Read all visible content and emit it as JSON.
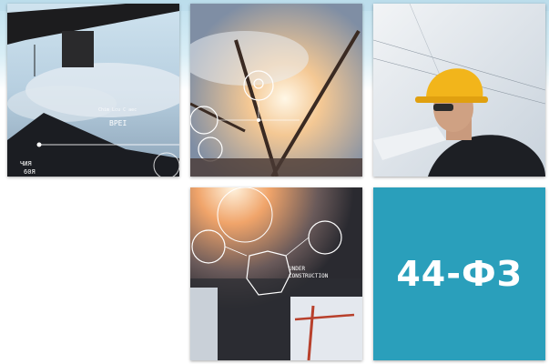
{
  "tiles": [
    {
      "id": "tile1",
      "overlay_texts": [
        "BPEI",
        "ЧИЯ",
        "60Я"
      ]
    },
    {
      "id": "tile2",
      "overlay_texts": []
    },
    {
      "id": "tile3",
      "overlay_texts": []
    },
    {
      "id": "tile4",
      "overlay_texts": [
        "UNDER",
        "CONSTRUCTION"
      ]
    },
    {
      "id": "tile5",
      "label": "44-ФЗ"
    }
  ],
  "colors": {
    "accent_tile": "#2a9fbb",
    "label_text": "#ffffff"
  }
}
